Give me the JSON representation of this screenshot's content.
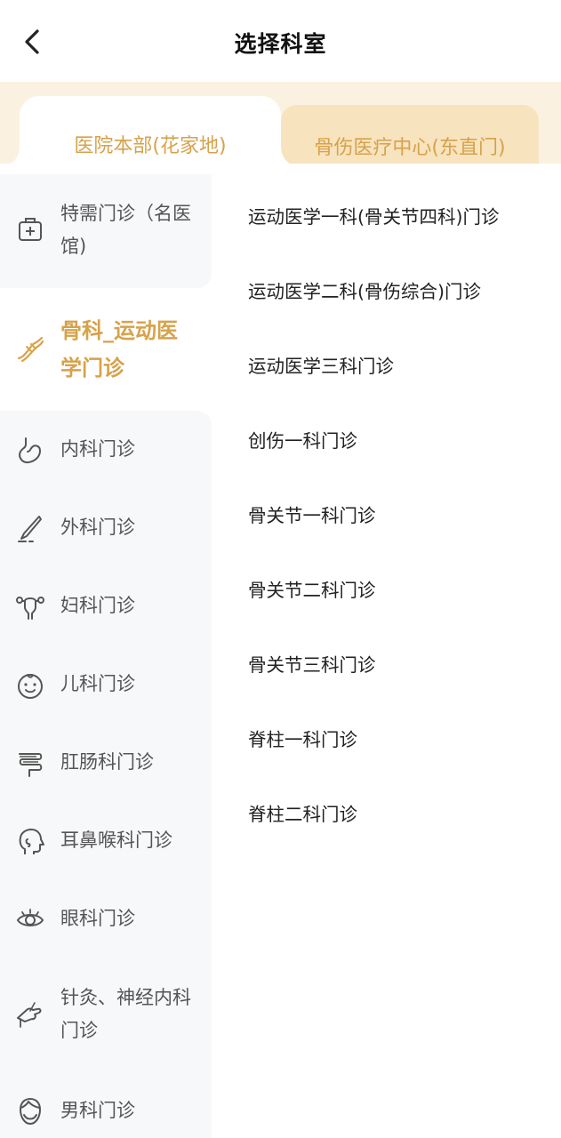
{
  "header": {
    "title": "选择科室",
    "back_icon": "chevron-left-icon"
  },
  "tabs": [
    {
      "label": "医院本部(花家地)",
      "active": true
    },
    {
      "label": "骨伤医疗中心(东直门)",
      "active": false
    }
  ],
  "sidebar": {
    "items": [
      {
        "label": "特需门诊（名医馆)",
        "icon": "medical-kit-icon"
      },
      {
        "label": "骨科_运动医学门诊",
        "icon": "bone-icon",
        "active": true
      },
      {
        "label": "内科门诊",
        "icon": "stomach-icon"
      },
      {
        "label": "外科门诊",
        "icon": "scalpel-icon"
      },
      {
        "label": "妇科门诊",
        "icon": "uterus-icon"
      },
      {
        "label": "儿科门诊",
        "icon": "baby-face-icon"
      },
      {
        "label": "肛肠科门诊",
        "icon": "intestine-icon"
      },
      {
        "label": "耳鼻喉科门诊",
        "icon": "head-profile-icon"
      },
      {
        "label": "眼科门诊",
        "icon": "eye-icon"
      },
      {
        "label": "针灸、神经内科门诊",
        "icon": "acupuncture-hand-icon"
      },
      {
        "label": "男科门诊",
        "icon": "male-face-icon"
      }
    ]
  },
  "departments": [
    "运动医学一科(骨关节四科)门诊",
    "运动医学二科(骨伤综合)门诊",
    "运动医学三科门诊",
    "创伤一科门诊",
    "骨关节一科门诊",
    "骨关节二科门诊",
    "骨关节三科门诊",
    "脊柱一科门诊",
    "脊柱二科门诊"
  ],
  "colors": {
    "accent": "#d6a24a",
    "tab_bar_bg": "#fbf1e1",
    "inactive_tab_bg": "#f8e3bf",
    "sidebar_bg": "#f7f8fa"
  }
}
